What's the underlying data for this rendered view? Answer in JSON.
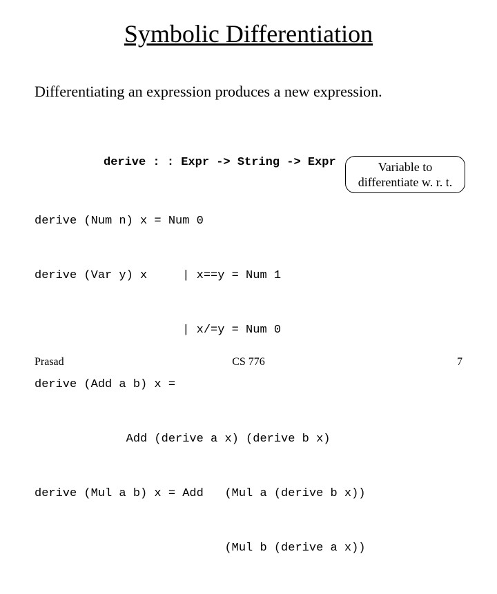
{
  "title": "Symbolic Differentiation",
  "subtitle": "Differentiating an expression produces a new expression.",
  "signature": "derive : : Expr -> String -> Expr",
  "code": {
    "l1": "derive (Num n) x = Num 0",
    "l2": "derive (Var y) x     | x==y = Num 1",
    "l3": "                     | x/=y = Num 0",
    "l4": "derive (Add a b) x =",
    "l5": "             Add (derive a x) (derive b x)",
    "l6": "derive (Mul a b) x = Add   (Mul a (derive b x))",
    "l7": "                           (Mul b (derive a x))"
  },
  "callout": {
    "line1": "Variable to",
    "line2": "differentiate w. r. t."
  },
  "footer": {
    "left": "Prasad",
    "center": "CS 776",
    "right": "7"
  }
}
